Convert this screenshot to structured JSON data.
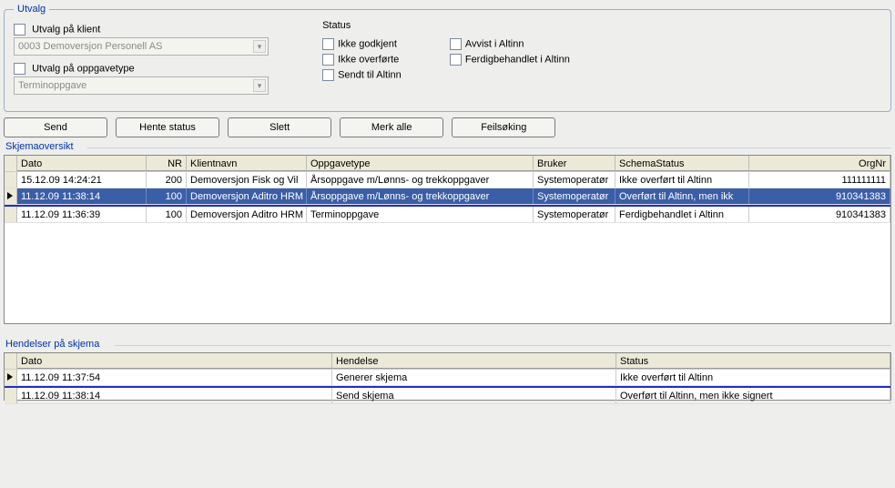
{
  "utvalg": {
    "legend": "Utvalg",
    "klient_chk_label": "Utvalg på klient",
    "klient_combo_value": "0003 Demoversjon Personell AS",
    "oppg_chk_label": "Utvalg på oppgavetype",
    "oppg_combo_value": "Terminoppgave",
    "status_heading": "Status",
    "status_opts_col1": [
      "Ikke godkjent",
      "Ikke overførte",
      "Sendt til Altinn"
    ],
    "status_opts_col2": [
      "Avvist i Altinn",
      "Ferdigbehandlet i Altinn"
    ]
  },
  "buttons": {
    "send": "Send",
    "hente": "Hente status",
    "slett": "Slett",
    "merk": "Merk alle",
    "feil": "Feilsøking"
  },
  "oversikt": {
    "title": "Skjemaoversikt",
    "headers": {
      "dato": "Dato",
      "nr": "NR",
      "klient": "Klientnavn",
      "oppg": "Oppgavetype",
      "bruker": "Bruker",
      "schema": "SchemaStatus",
      "org": "OrgNr"
    },
    "rows": [
      {
        "dato": "15.12.09 14:24:21",
        "nr": "200",
        "klient": "Demoversjon Fisk og Vil",
        "oppg": "Årsoppgave m/Lønns- og trekkoppgaver",
        "bruker": "Systemoperatør",
        "schema": "Ikke overført til Altinn",
        "org": "111111111"
      },
      {
        "dato": "11.12.09 11:38:14",
        "nr": "100",
        "klient": "Demoversjon Aditro HRM",
        "oppg": "Årsoppgave m/Lønns- og trekkoppgaver",
        "bruker": "Systemoperatør",
        "schema": "Overført til Altinn, men ikk",
        "org": "910341383"
      },
      {
        "dato": "11.12.09 11:36:39",
        "nr": "100",
        "klient": "Demoversjon Aditro HRM",
        "oppg": "Terminoppgave",
        "bruker": "Systemoperatør",
        "schema": "Ferdigbehandlet i Altinn",
        "org": "910341383"
      }
    ],
    "selected_index": 1
  },
  "hendelser": {
    "title": "Hendelser på skjema",
    "headers": {
      "dato": "Dato",
      "hend": "Hendelse",
      "stat": "Status"
    },
    "rows": [
      {
        "dato": "11.12.09 11:37:54",
        "hend": "Generer skjema",
        "stat": "Ikke overført til Altinn"
      },
      {
        "dato": "11.12.09 11:38:14",
        "hend": "Send skjema",
        "stat": "Overført til Altinn, men ikke signert"
      }
    ],
    "selected_index": 0
  }
}
